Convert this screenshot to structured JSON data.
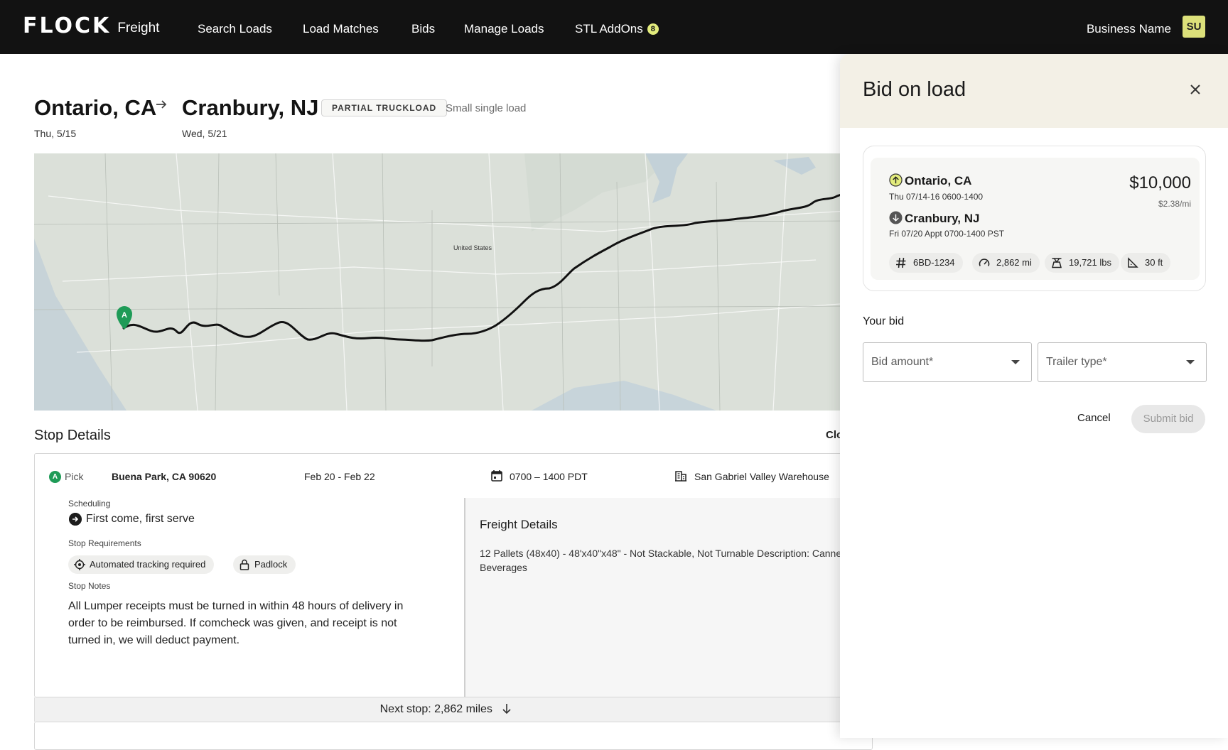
{
  "nav": {
    "logo_mark": "FLOCK",
    "logo_sub": "Freight",
    "items": [
      "Search Loads",
      "Load Matches",
      "Bids",
      "Manage Loads",
      "STL AddOns"
    ],
    "addon_badge": "8",
    "business_name": "Business Name",
    "avatar_initials": "SU"
  },
  "header": {
    "origin_city": "Ontario, CA",
    "origin_date": "Thu, 5/15",
    "dest_city": "Cranbury, NJ",
    "dest_date": "Wed, 5/21",
    "load_type_badge": "PARTIAL TRUCKLOAD",
    "load_size": "Small single load"
  },
  "map": {
    "country_label": "United States",
    "pin_label": "A"
  },
  "stop_details": {
    "title": "Stop Details",
    "collapse_label": "Clo",
    "stop": {
      "pin": "A",
      "type": "Pick",
      "address": "Buena Park, CA 90620",
      "dates": "Feb 20 - Feb 22",
      "hours": "0700 – 1400 PDT",
      "facility": "San Gabriel Valley Warehouse",
      "scheduling_label": "Scheduling",
      "scheduling_value": "First come, first serve",
      "requirements_label": "Stop Requirements",
      "requirements": [
        "Automated tracking required",
        "Padlock"
      ],
      "notes_label": "Stop Notes",
      "notes": "All Lumper receipts must be turned in within 48 hours of delivery in order to be reimbursed. If comcheck was given, and receipt is not turned in, we will deduct payment.",
      "freight_title": "Freight Details",
      "freight_text": "12 Pallets (48x40) - 48'x40\"x48\" - Not Stackable, Not Turnable Description: Canned Beverages"
    },
    "next_stop": "Next stop: 2,862 miles"
  },
  "bid_panel": {
    "title": "Bid on load",
    "origin_city": "Ontario, CA",
    "origin_time": "Thu 07/14-16 0600-1400",
    "dest_city": "Cranbury, NJ",
    "dest_time": "Fri 07/20 Appt 0700-1400 PST",
    "price": "$10,000",
    "per_mile": "$2.38/mi",
    "meta": {
      "load_id": "6BD-1234",
      "distance": "2,862 mi",
      "weight": "19,721 lbs",
      "length": "30 ft"
    },
    "your_bid_label": "Your bid",
    "bid_amount_placeholder": "Bid amount*",
    "trailer_type_placeholder": "Trailer type*",
    "cancel_label": "Cancel",
    "submit_label": "Submit bid"
  },
  "colors": {
    "nav_bg": "#121212",
    "accent_yellow": "#e3ec7d",
    "pick_green": "#1e9b57",
    "panel_header": "#f3f0e6"
  }
}
